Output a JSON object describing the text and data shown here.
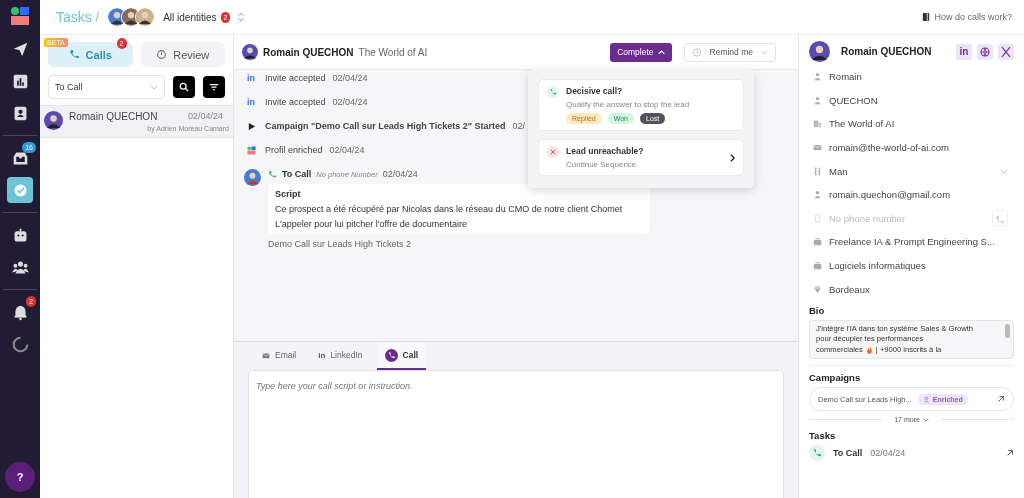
{
  "sidebar": {
    "items": [
      {
        "kind": "send",
        "selected": false
      },
      {
        "kind": "chart",
        "selected": false
      },
      {
        "kind": "contacts",
        "selected": false
      },
      {
        "kind": "inbox",
        "selected": false,
        "badge": "16"
      },
      {
        "kind": "tasks",
        "selected": true
      },
      {
        "kind": "bot",
        "selected": false
      },
      {
        "kind": "team",
        "selected": false
      },
      {
        "kind": "bell",
        "selected": false,
        "badge": "2"
      },
      {
        "kind": "spinner",
        "selected": false
      }
    ],
    "help": "?"
  },
  "header": {
    "title": "Tasks",
    "separator": "/",
    "identities": "All identities",
    "identities_badge": "2",
    "help_link": "How do calls work?"
  },
  "task_tabs": [
    {
      "label": "Calls",
      "selected": true,
      "tag": "BETA",
      "badge": "2",
      "kind": "phone"
    },
    {
      "label": "Review",
      "selected": false,
      "kind": "review"
    }
  ],
  "filter": {
    "value": "To Call"
  },
  "task_list": [
    {
      "name": "Romain QUECHON",
      "date": "02/04/24",
      "by": "by Adrien Moreau Camard",
      "selected": true
    }
  ],
  "lead": {
    "name": "Romain QUECHON",
    "company": "The World of AI",
    "complete": "Complete",
    "remind": "Remind me"
  },
  "timeline": [
    {
      "kind": "linkedin",
      "icon": "in",
      "text": "Invite accepted",
      "date": "02/04/24"
    },
    {
      "kind": "linkedin",
      "icon": "in",
      "text": "Invite accepted",
      "date": "02/04/24"
    },
    {
      "kind": "campaign",
      "text": "Campaign \"Demo Call sur Leads High Tickets 2\" Started",
      "date": "02/"
    },
    {
      "kind": "enrich",
      "text": "Profil enriched",
      "date": "02/04/24"
    },
    {
      "kind": "task",
      "text": "To Call",
      "note": "No phone Number",
      "date": "02/04/24",
      "script_title": "Script",
      "script": [
        "Ce prospect a été récupéré par Nicolas dans le réseau du CMO de notre client Chomet",
        "L'appeler pour lui pitcher l'offre de documentaire"
      ],
      "campaign": "Demo Call sur Leads High Tickets 2"
    }
  ],
  "complete_menu": [
    {
      "kind": "decisive",
      "title": "Decisive call?",
      "subtitle": "Qualify the answer to stop the lead",
      "tags": [
        {
          "label": "Replied",
          "color": "#fde8c2"
        },
        {
          "label": "Won",
          "color": "#d3f5e1"
        },
        {
          "label": "Lost",
          "color": "#55505c"
        }
      ]
    },
    {
      "kind": "unreachable",
      "title": "Lead unreachable?",
      "subtitle": "Continue Sequence"
    }
  ],
  "composer": {
    "tabs": [
      {
        "label": "Email",
        "kind": "email",
        "selected": false
      },
      {
        "label": "LinkedIn",
        "kind": "linkedin",
        "icon": "in",
        "selected": false
      },
      {
        "label": "Call",
        "kind": "call",
        "selected": true
      }
    ],
    "placeholder": "Type here your call script or instruction."
  },
  "profile": {
    "name": "Romain QUECHON",
    "linkedin": "in",
    "fields": [
      {
        "kind": "person",
        "value": "Romain"
      },
      {
        "kind": "person",
        "value": "QUECHON"
      },
      {
        "kind": "building",
        "value": "The World of AI"
      },
      {
        "kind": "mail",
        "value": "romain@the-world-of-ai.com"
      },
      {
        "kind": "gender",
        "value": "Man"
      },
      {
        "kind": "person",
        "value": "romain.quechon@gmail.com"
      },
      {
        "kind": "phone",
        "placeholder": "No phone number"
      },
      {
        "kind": "job",
        "value": "Freelance IA & Prompt Engineering S..."
      },
      {
        "kind": "industry",
        "value": "Logiciels informatiques"
      },
      {
        "kind": "pin",
        "value": "Bordeaux"
      }
    ],
    "bio_title": "Bio",
    "bio": [
      "J'intègre l'IA dans ton système Sales & Growth",
      "pour décupler tes performances",
      "commerciales",
      "| +9000 inscrits à la"
    ],
    "campaigns_title": "Campaigns",
    "campaigns": [
      {
        "name": "Demo Call sur Leads High...",
        "status": "Enriched"
      }
    ],
    "more": "17 more",
    "tasks_title": "Tasks",
    "tasks": [
      {
        "label": "To Call",
        "date": "02/04/24"
      }
    ]
  }
}
